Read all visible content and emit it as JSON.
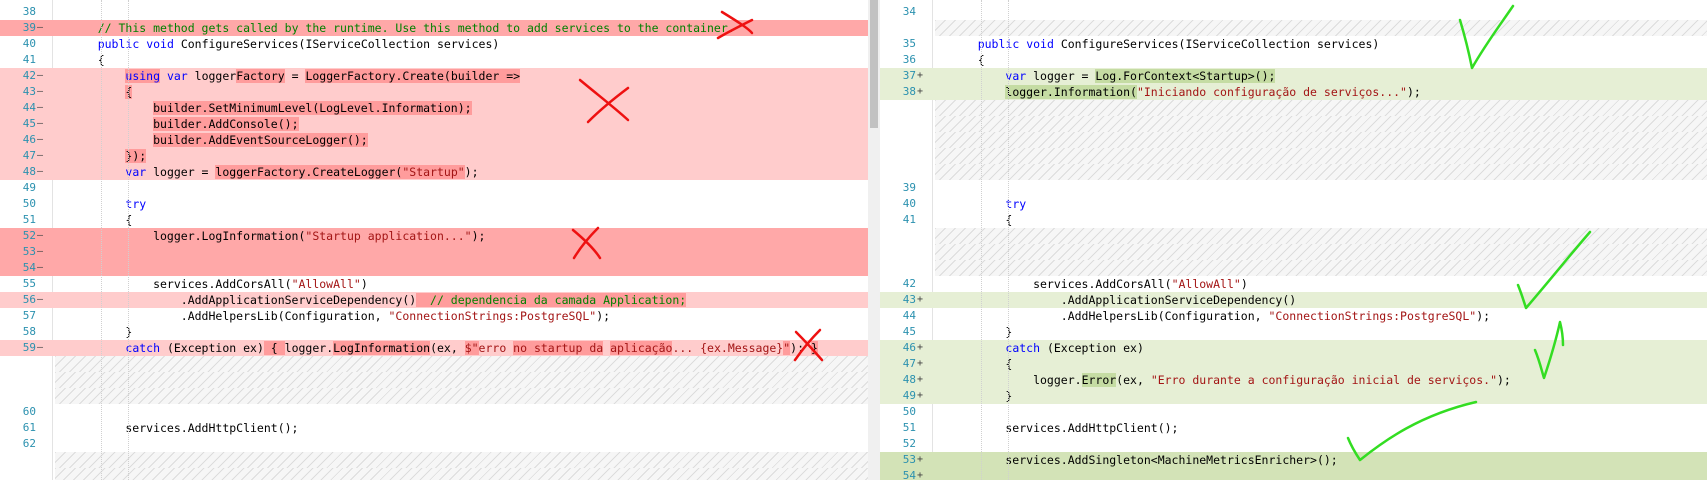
{
  "left": {
    "rows": [
      {
        "n": "38",
        "m": "",
        "t": "empty",
        "code": []
      },
      {
        "n": "39",
        "m": "—",
        "t": "del-strong",
        "code": [
          [
            "    ",
            ""
          ],
          [
            "// This method gets called by the runtime. Use this method to add services to the container.",
            "cm"
          ]
        ]
      },
      {
        "n": "40",
        "m": "",
        "t": "empty",
        "code": [
          [
            "    ",
            ""
          ],
          [
            "public",
            "kw"
          ],
          [
            " ",
            ""
          ],
          [
            "void",
            "kw"
          ],
          [
            " ConfigureServices(IServiceCollection services)",
            ""
          ]
        ]
      },
      {
        "n": "41",
        "m": "",
        "t": "empty",
        "code": [
          [
            "    {",
            ""
          ]
        ]
      },
      {
        "n": "42",
        "m": "—",
        "t": "del",
        "code": [
          [
            "        ",
            ""
          ],
          [
            "using",
            "kw hl"
          ],
          [
            " ",
            ""
          ],
          [
            "var",
            "kw"
          ],
          [
            " logger",
            ""
          ],
          [
            "Factory",
            "hl"
          ],
          [
            " = ",
            ""
          ],
          [
            "LoggerFactory.Create(builder =>",
            "hl"
          ]
        ]
      },
      {
        "n": "43",
        "m": "—",
        "t": "del",
        "code": [
          [
            "        ",
            ""
          ],
          [
            "{",
            "hl"
          ]
        ]
      },
      {
        "n": "44",
        "m": "—",
        "t": "del",
        "code": [
          [
            "            ",
            ""
          ],
          [
            "builder.SetMinimumLevel(LogLevel.Information);",
            "hl"
          ]
        ]
      },
      {
        "n": "45",
        "m": "—",
        "t": "del",
        "code": [
          [
            "            ",
            ""
          ],
          [
            "builder.AddConsole();",
            "hl"
          ]
        ]
      },
      {
        "n": "46",
        "m": "—",
        "t": "del",
        "code": [
          [
            "            ",
            ""
          ],
          [
            "builder.AddEventSourceLogger();",
            "hl"
          ]
        ]
      },
      {
        "n": "47",
        "m": "—",
        "t": "del",
        "code": [
          [
            "        ",
            ""
          ],
          [
            "});",
            "hl"
          ]
        ]
      },
      {
        "n": "48",
        "m": "—",
        "t": "del",
        "code": [
          [
            "        ",
            ""
          ],
          [
            "var",
            "kw"
          ],
          [
            " logger = ",
            ""
          ],
          [
            "loggerFactory.CreateLogger(",
            "hl"
          ],
          [
            "\"Startup\"",
            "str hl"
          ],
          [
            ");",
            ""
          ]
        ]
      },
      {
        "n": "49",
        "m": "",
        "t": "empty",
        "code": []
      },
      {
        "n": "50",
        "m": "",
        "t": "empty",
        "code": [
          [
            "        ",
            ""
          ],
          [
            "try",
            "kw"
          ]
        ]
      },
      {
        "n": "51",
        "m": "",
        "t": "empty",
        "code": [
          [
            "        {",
            ""
          ]
        ]
      },
      {
        "n": "52",
        "m": "—",
        "t": "del-strong",
        "code": [
          [
            "            logger.LogInformation(",
            ""
          ],
          [
            "\"Startup application...\"",
            "str"
          ],
          [
            ");",
            ""
          ]
        ]
      },
      {
        "n": "53",
        "m": "—",
        "t": "del-strong",
        "code": []
      },
      {
        "n": "54",
        "m": "—",
        "t": "del-strong",
        "code": []
      },
      {
        "n": "55",
        "m": "",
        "t": "empty",
        "code": [
          [
            "            services.AddCorsAll(",
            ""
          ],
          [
            "\"AllowAll\"",
            "str"
          ],
          [
            ")",
            ""
          ]
        ]
      },
      {
        "n": "56",
        "m": "—",
        "t": "del",
        "code": [
          [
            "                .AddApplicationServiceDependency()",
            ""
          ],
          [
            "  // dependencia da camada Application;",
            "cm hl"
          ]
        ]
      },
      {
        "n": "57",
        "m": "",
        "t": "empty",
        "code": [
          [
            "                .AddHelpersLib(Configuration, ",
            ""
          ],
          [
            "\"ConnectionStrings:PostgreSQL\"",
            "str"
          ],
          [
            ");",
            ""
          ]
        ]
      },
      {
        "n": "58",
        "m": "",
        "t": "empty",
        "code": [
          [
            "        }",
            ""
          ]
        ]
      },
      {
        "n": "59",
        "m": "—",
        "t": "del",
        "code": [
          [
            "        ",
            ""
          ],
          [
            "catch",
            "kw"
          ],
          [
            " (Exception ex)",
            ""
          ],
          [
            " { ",
            "hl"
          ],
          [
            "logger.",
            ""
          ],
          [
            "LogInformation",
            "hl"
          ],
          [
            "(ex, ",
            ""
          ],
          [
            "$\"",
            "str hl"
          ],
          [
            "erro ",
            "str"
          ],
          [
            "no startup da",
            "str hl"
          ],
          [
            " ",
            ""
          ],
          [
            "aplicação",
            "str hl"
          ],
          [
            "... {ex.Message}",
            "str"
          ],
          [
            "\"",
            "str hl"
          ],
          [
            "); ",
            ""
          ],
          [
            "}",
            "hl"
          ]
        ]
      },
      {
        "n": "",
        "m": "",
        "t": "hatch",
        "code": []
      },
      {
        "n": "",
        "m": "",
        "t": "hatch",
        "code": []
      },
      {
        "n": "",
        "m": "",
        "t": "hatch",
        "code": []
      },
      {
        "n": "60",
        "m": "",
        "t": "empty",
        "code": []
      },
      {
        "n": "61",
        "m": "",
        "t": "empty",
        "code": [
          [
            "        services.AddHttpClient();",
            ""
          ]
        ]
      },
      {
        "n": "62",
        "m": "",
        "t": "empty",
        "code": []
      },
      {
        "n": "",
        "m": "",
        "t": "hatch",
        "code": []
      },
      {
        "n": "",
        "m": "",
        "t": "hatch",
        "code": []
      },
      {
        "n": "",
        "m": "",
        "t": "empty",
        "code": []
      }
    ]
  },
  "right": {
    "rows": [
      {
        "n": "34",
        "m": "",
        "t": "empty",
        "code": []
      },
      {
        "n": "",
        "m": "",
        "t": "hatch",
        "code": []
      },
      {
        "n": "35",
        "m": "",
        "t": "empty",
        "code": [
          [
            "    ",
            ""
          ],
          [
            "public",
            "kw"
          ],
          [
            " ",
            ""
          ],
          [
            "void",
            "kw"
          ],
          [
            " ConfigureServices(IServiceCollection services)",
            ""
          ]
        ]
      },
      {
        "n": "36",
        "m": "",
        "t": "empty",
        "code": [
          [
            "    {",
            ""
          ]
        ]
      },
      {
        "n": "37",
        "m": "+",
        "t": "add",
        "code": [
          [
            "        ",
            ""
          ],
          [
            "var",
            "kw"
          ],
          [
            " logger = ",
            ""
          ],
          [
            "Log.ForContext<Startup>();",
            "hl-add"
          ]
        ]
      },
      {
        "n": "38",
        "m": "+",
        "t": "add",
        "code": [
          [
            "        ",
            ""
          ],
          [
            "logger.Information(",
            "hl-add"
          ],
          [
            "\"Iniciando configuração de serviços...\"",
            "str"
          ],
          [
            ");",
            ""
          ]
        ]
      },
      {
        "n": "",
        "m": "",
        "t": "hatch",
        "code": []
      },
      {
        "n": "",
        "m": "",
        "t": "hatch",
        "code": []
      },
      {
        "n": "",
        "m": "",
        "t": "hatch",
        "code": []
      },
      {
        "n": "",
        "m": "",
        "t": "hatch",
        "code": []
      },
      {
        "n": "",
        "m": "",
        "t": "hatch",
        "code": []
      },
      {
        "n": "39",
        "m": "",
        "t": "empty",
        "code": []
      },
      {
        "n": "40",
        "m": "",
        "t": "empty",
        "code": [
          [
            "        ",
            ""
          ],
          [
            "try",
            "kw"
          ]
        ]
      },
      {
        "n": "41",
        "m": "",
        "t": "empty",
        "code": [
          [
            "        {",
            ""
          ]
        ]
      },
      {
        "n": "",
        "m": "",
        "t": "hatch",
        "code": []
      },
      {
        "n": "",
        "m": "",
        "t": "hatch",
        "code": []
      },
      {
        "n": "",
        "m": "",
        "t": "hatch",
        "code": []
      },
      {
        "n": "42",
        "m": "",
        "t": "empty",
        "code": [
          [
            "            services.AddCorsAll(",
            ""
          ],
          [
            "\"AllowAll\"",
            "str"
          ],
          [
            ")",
            ""
          ]
        ]
      },
      {
        "n": "43",
        "m": "+",
        "t": "add",
        "code": [
          [
            "                .AddApplicationServiceDependency()",
            ""
          ]
        ]
      },
      {
        "n": "44",
        "m": "",
        "t": "empty",
        "code": [
          [
            "                .AddHelpersLib(Configuration, ",
            ""
          ],
          [
            "\"ConnectionStrings:PostgreSQL\"",
            "str"
          ],
          [
            ");",
            ""
          ]
        ]
      },
      {
        "n": "45",
        "m": "",
        "t": "empty",
        "code": [
          [
            "        }",
            ""
          ]
        ]
      },
      {
        "n": "46",
        "m": "+",
        "t": "add",
        "code": [
          [
            "        ",
            ""
          ],
          [
            "catch",
            "kw"
          ],
          [
            " (Exception ex)",
            ""
          ]
        ]
      },
      {
        "n": "47",
        "m": "+",
        "t": "add",
        "code": [
          [
            "        {",
            ""
          ]
        ]
      },
      {
        "n": "48",
        "m": "+",
        "t": "add",
        "code": [
          [
            "            logger.",
            ""
          ],
          [
            "Error",
            "hl-add"
          ],
          [
            "(ex, ",
            ""
          ],
          [
            "\"Erro durante a configuração inicial de serviços.\"",
            "str"
          ],
          [
            ");",
            ""
          ]
        ]
      },
      {
        "n": "49",
        "m": "+",
        "t": "add",
        "code": [
          [
            "        }",
            ""
          ]
        ]
      },
      {
        "n": "50",
        "m": "",
        "t": "empty",
        "code": []
      },
      {
        "n": "51",
        "m": "",
        "t": "empty",
        "code": [
          [
            "        services.AddHttpClient();",
            ""
          ]
        ]
      },
      {
        "n": "52",
        "m": "",
        "t": "empty",
        "code": []
      },
      {
        "n": "53",
        "m": "+",
        "t": "add-strong",
        "code": [
          [
            "        services.AddSingleton<MachineMetricsEnricher>();",
            ""
          ]
        ]
      },
      {
        "n": "54",
        "m": "+",
        "t": "add-strong",
        "code": []
      },
      {
        "n": "",
        "m": "",
        "t": "empty",
        "code": []
      }
    ]
  },
  "colors": {
    "deleted": "#ffcccc",
    "deleted_strong": "#ffa8a8",
    "added": "#e6efd5",
    "added_strong": "#d3e3b7",
    "line_number": "#2b91af",
    "keyword": "#0000ff",
    "string": "#a31515",
    "comment": "#008000",
    "red_mark": "#ee1111",
    "green_mark": "#33dd22"
  }
}
